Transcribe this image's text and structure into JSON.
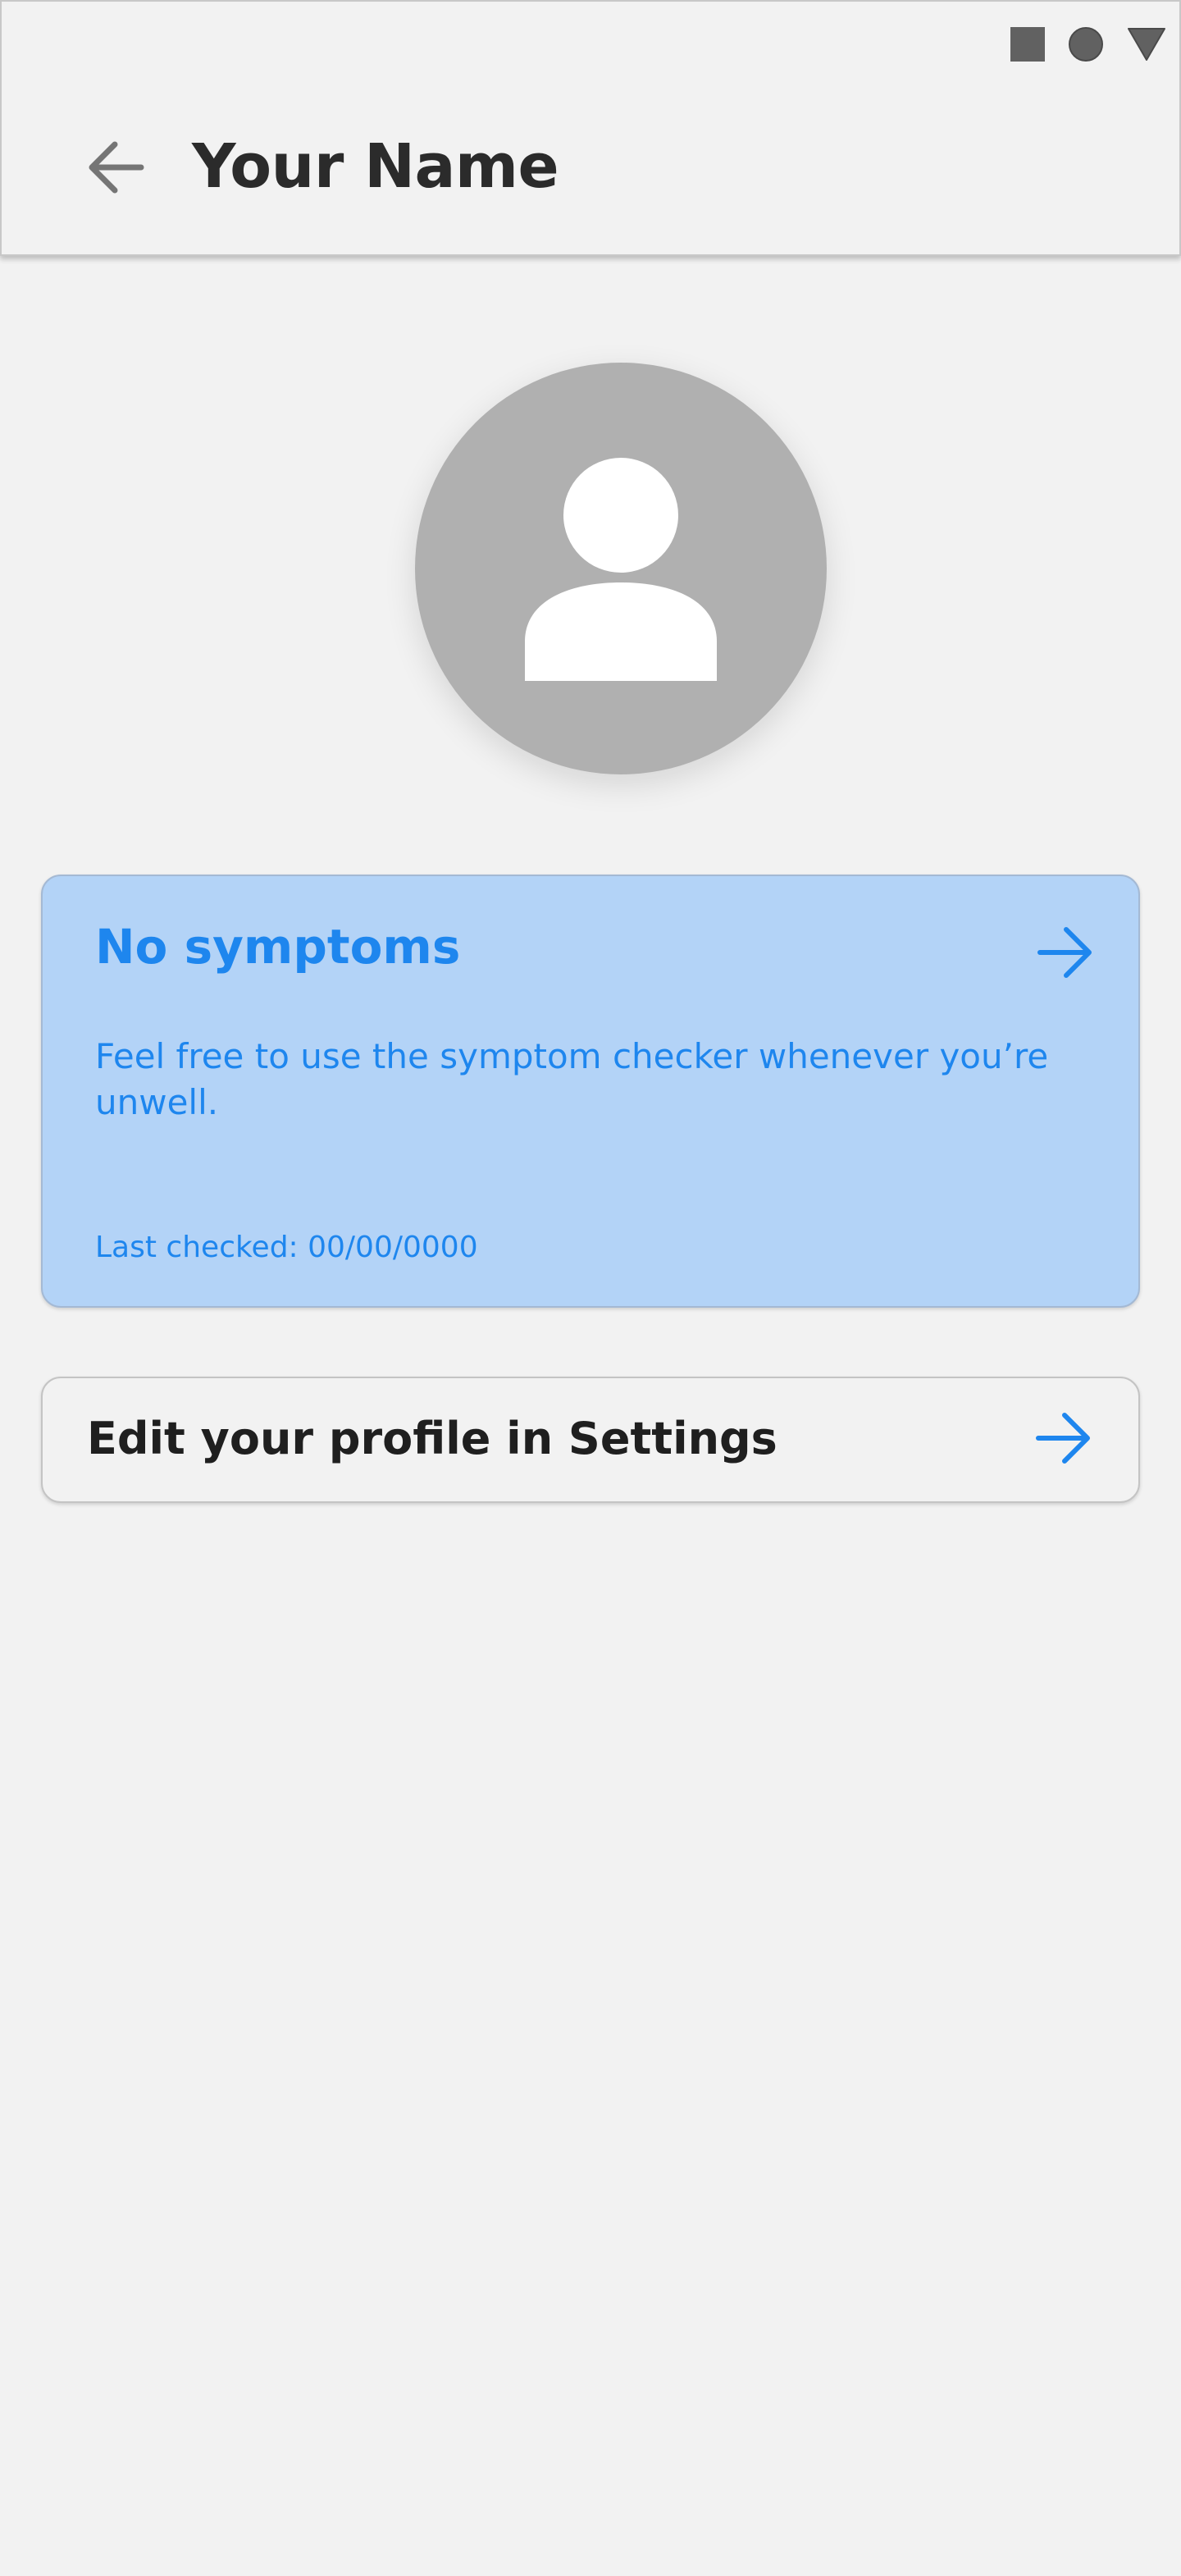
{
  "status_bar": {
    "icons": [
      "square-icon",
      "circle-icon",
      "triangle-down-icon"
    ]
  },
  "header": {
    "back_icon": "arrow-left-icon",
    "title": "Your Name"
  },
  "profile": {
    "avatar_icon": "person-icon"
  },
  "symptom_card": {
    "title": "No symptoms",
    "description": "Feel free to use the symptom checker whenever you’re unwell.",
    "last_checked": "Last checked: 00/00/0000",
    "arrow_icon": "arrow-right-icon"
  },
  "settings_row": {
    "label": "Edit your profile in Settings",
    "arrow_icon": "arrow-right-icon"
  },
  "colors": {
    "background": "#f2f2f2",
    "accent_blue": "#1e86ee",
    "card_blue": "#b3d3f7",
    "avatar_grey": "#b0b0b0",
    "title_text": "#2b2b2b"
  }
}
